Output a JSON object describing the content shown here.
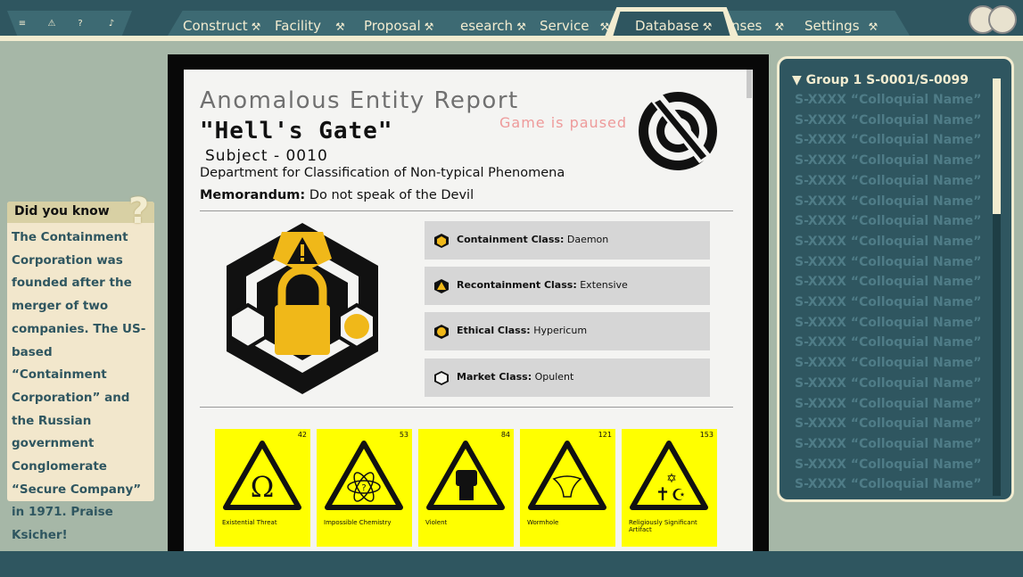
{
  "topbar": {
    "icon_buttons": [
      "list-icon",
      "warning-icon",
      "help-icon",
      "bell-icon"
    ],
    "tabs": [
      {
        "label": "Construct",
        "icon": "hammer-icon"
      },
      {
        "label": "Facility",
        "icon": "hammer-icon"
      },
      {
        "label": "Proposal",
        "icon": "hammer-icon"
      },
      {
        "label": "esearch",
        "icon": "hammer-icon"
      },
      {
        "label": "Service",
        "icon": "hammer-icon"
      },
      {
        "label": "Database",
        "icon": "hammer-icon"
      },
      {
        "label": "nses",
        "icon": "hammer-icon"
      },
      {
        "label": "Settings",
        "icon": "hammer-icon"
      }
    ],
    "active_tab": "Database"
  },
  "did_you_know": {
    "title": "Did you know",
    "body": "The Containment Corporation was founded after the merger of two companies. The US-based “Containment Corporation” and the Russian government Conglomerate “Secure Company” in 1971. Praise Ksicher!"
  },
  "report": {
    "title": "Anomalous Entity Report",
    "name": "\"Hell's Gate\"",
    "subject": "Subject - 0010",
    "department": "Department for Classification of Non-typical Phenomena",
    "memo_label": "Memorandum:",
    "memo_text": "Do not speak of the Devil",
    "paused_text": "Game is paused",
    "classes": [
      {
        "label": "Containment Class:",
        "value": "Daemon",
        "icon": "cube-icon"
      },
      {
        "label": "Recontainment Class:",
        "value": "Extensive",
        "icon": "warning-hex-icon"
      },
      {
        "label": "Ethical Class:",
        "value": "Hypericum",
        "icon": "yellow-hex-icon"
      },
      {
        "label": "Market Class:",
        "value": "Opulent",
        "icon": "white-hex-icon"
      }
    ],
    "hazards": [
      {
        "num": "42",
        "label": "Existential Threat",
        "icon": "omega-icon"
      },
      {
        "num": "53",
        "label": "Impossible Chemistry",
        "icon": "atom-icon"
      },
      {
        "num": "84",
        "label": "Violent",
        "icon": "fist-icon"
      },
      {
        "num": "121",
        "label": "Wormhole",
        "icon": "funnel-icon"
      },
      {
        "num": "153",
        "label": "Religiously Significant Artifact",
        "icon": "religious-symbols-icon"
      }
    ]
  },
  "database": {
    "group": "Group 1 S-0001/S-0099",
    "entries": [
      "S-XXXX “Colloquial Name”",
      "S-XXXX “Colloquial Name”",
      "S-XXXX “Colloquial Name”",
      "S-XXXX “Colloquial Name”",
      "S-XXXX “Colloquial Name”",
      "S-XXXX “Colloquial Name”",
      "S-XXXX “Colloquial Name”",
      "S-XXXX “Colloquial Name”",
      "S-XXXX “Colloquial Name”",
      "S-XXXX “Colloquial Name”",
      "S-XXXX “Colloquial Name”",
      "S-XXXX “Colloquial Name”",
      "S-XXXX “Colloquial Name”",
      "S-XXXX “Colloquial Name”",
      "S-XXXX “Colloquial Name”",
      "S-XXXX “Colloquial Name”",
      "S-XXXX “Colloquial Name”",
      "S-XXXX “Colloquial Name”",
      "S-XXXX “Colloquial Name”",
      "S-XXXX “Colloquial Name”"
    ]
  },
  "colors": {
    "panel": "#2f5660",
    "cream": "#f2ecd0",
    "background": "#a6b7a7",
    "hazard_yellow": "#ffff00",
    "emblem_yellow": "#f0b819"
  }
}
